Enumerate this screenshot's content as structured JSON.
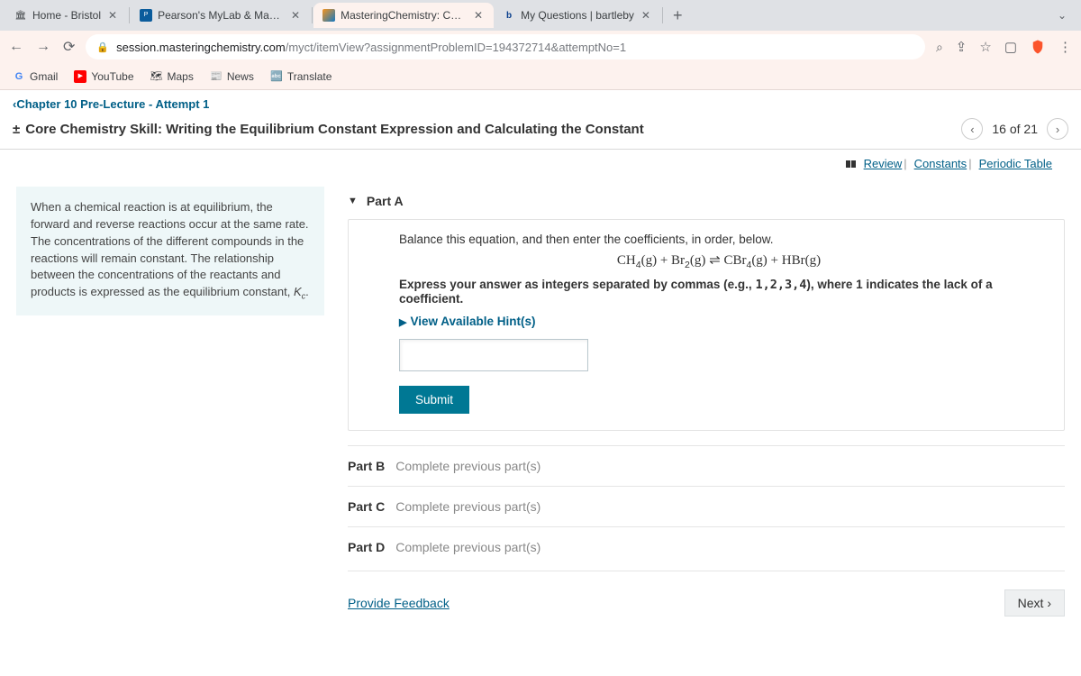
{
  "browser": {
    "tabs": [
      {
        "label": "Home - Bristol",
        "closeable": true
      },
      {
        "label": "Pearson's MyLab & Mastering",
        "closeable": true
      },
      {
        "label": "MasteringChemistry: Chapter 1",
        "closeable": true,
        "active": true
      },
      {
        "label": "My Questions | bartleby",
        "closeable": true
      }
    ],
    "url_domain": "session.masteringchemistry.com",
    "url_path": "/myct/itemView?assignmentProblemID=194372714&attemptNo=1",
    "bookmarks": [
      {
        "label": "Gmail"
      },
      {
        "label": "YouTube"
      },
      {
        "label": "Maps"
      },
      {
        "label": "News"
      },
      {
        "label": "Translate"
      }
    ]
  },
  "breadcrumb": {
    "prefix": "‹",
    "label": "Chapter 10 Pre-Lecture - Attempt 1"
  },
  "page_title": "Core Chemistry Skill: Writing the Equilibrium Constant Expression and Calculating the Constant",
  "pager": {
    "label": "16 of 21"
  },
  "toolbar_links": {
    "review": "Review",
    "constants": "Constants",
    "periodic": "Periodic Table"
  },
  "intro_text": "When a chemical reaction is at equilibrium, the forward and reverse reactions occur at the same rate. The concentrations of the different compounds in the reactions will remain constant. The relationship between the concentrations of the reactants and products is expressed as the equilibrium constant, ",
  "intro_symbol": "K",
  "intro_sub": "c",
  "partA": {
    "label": "Part A",
    "question": "Balance this equation, and then enter the coefficients, in order, below.",
    "instruction_pre": "Express your answer as integers separated by commas (e.g., ",
    "instruction_code": "1,2,3,4",
    "instruction_post": "), where 1 indicates the lack of a coefficient.",
    "hints_label": "View Available Hint(s)",
    "submit_label": "Submit"
  },
  "equation": "CH₄(g) + Br₂(g) ⇌ CBr₄(g) + HBr(g)",
  "locked": [
    {
      "label": "Part B",
      "msg": "Complete previous part(s)"
    },
    {
      "label": "Part C",
      "msg": "Complete previous part(s)"
    },
    {
      "label": "Part D",
      "msg": "Complete previous part(s)"
    }
  ],
  "footer": {
    "feedback": "Provide Feedback",
    "next": "Next ›"
  }
}
